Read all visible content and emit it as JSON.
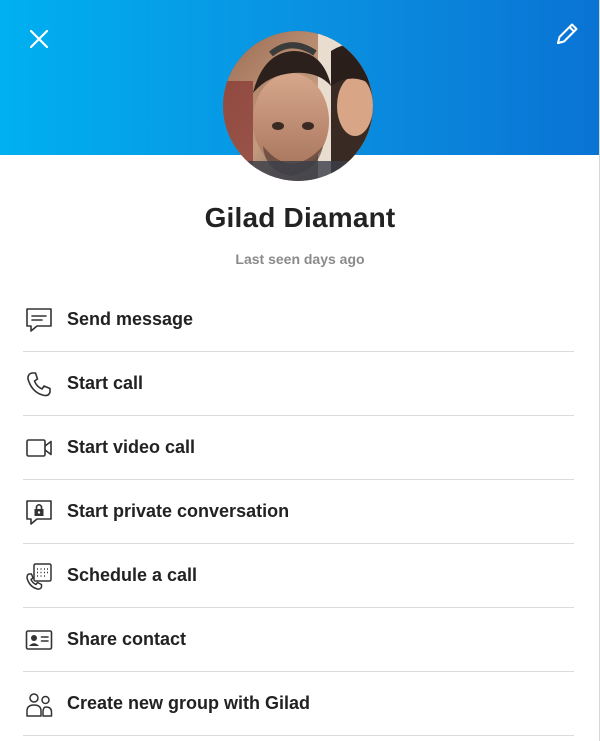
{
  "header": {
    "gradient_colors": [
      "#00b0f0",
      "#0a73d4"
    ],
    "close_icon": "close-icon",
    "edit_icon": "pencil-icon"
  },
  "profile": {
    "name": "Gilad Diamant",
    "status": "Last seen days ago"
  },
  "actions": [
    {
      "label": "Send message",
      "icon": "message-icon"
    },
    {
      "label": "Start call",
      "icon": "phone-icon"
    },
    {
      "label": "Start video call",
      "icon": "video-camera-icon"
    },
    {
      "label": "Start private conversation",
      "icon": "lock-message-icon"
    },
    {
      "label": "Schedule a call",
      "icon": "calendar-phone-icon"
    },
    {
      "label": "Share contact",
      "icon": "contact-card-icon"
    },
    {
      "label": "Create new group with Gilad",
      "icon": "group-icon"
    }
  ]
}
